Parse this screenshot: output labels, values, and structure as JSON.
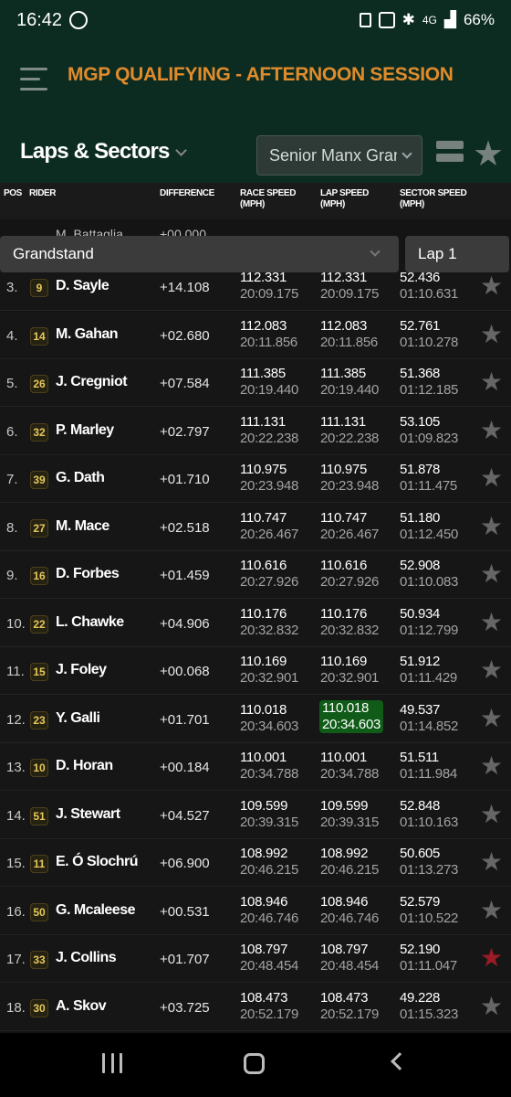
{
  "status_bar": {
    "time": "16:42",
    "battery": "66%",
    "network": "4G"
  },
  "header": {
    "title": "MGP QUALIFYING - AFTERNOON SESSION",
    "view_selector": "Laps & Sectors",
    "race_selector": "Senior Manx Grand Prix"
  },
  "columns": {
    "pos": "POS",
    "rider": "RIDER",
    "difference": "DIFFERENCE",
    "race_speed": "RACE SPEED (MPH)",
    "lap_speed": "LAP SPEED (MPH)",
    "sector_speed": "SECTOR SPEED (MPH)"
  },
  "partial_row": {
    "rider": "M. Battaglia",
    "diff": "+00.000"
  },
  "filters": {
    "sector": "Grandstand",
    "lap": "Lap 1"
  },
  "rows": [
    {
      "pos": "3.",
      "num": "9",
      "rider": "D. Sayle",
      "diff": "+14.108",
      "race_speed": "112.331",
      "race_time": "20:09.175",
      "lap_speed": "112.331",
      "lap_time": "20:09.175",
      "sector_speed": "52.436",
      "sector_time": "01:10.631",
      "best": false,
      "fav": false
    },
    {
      "pos": "4.",
      "num": "14",
      "rider": "M. Gahan",
      "diff": "+02.680",
      "race_speed": "112.083",
      "race_time": "20:11.856",
      "lap_speed": "112.083",
      "lap_time": "20:11.856",
      "sector_speed": "52.761",
      "sector_time": "01:10.278",
      "best": false,
      "fav": false
    },
    {
      "pos": "5.",
      "num": "26",
      "rider": "J. Cregniot",
      "diff": "+07.584",
      "race_speed": "111.385",
      "race_time": "20:19.440",
      "lap_speed": "111.385",
      "lap_time": "20:19.440",
      "sector_speed": "51.368",
      "sector_time": "01:12.185",
      "best": false,
      "fav": false
    },
    {
      "pos": "6.",
      "num": "32",
      "rider": "P. Marley",
      "diff": "+02.797",
      "race_speed": "111.131",
      "race_time": "20:22.238",
      "lap_speed": "111.131",
      "lap_time": "20:22.238",
      "sector_speed": "53.105",
      "sector_time": "01:09.823",
      "best": false,
      "fav": false
    },
    {
      "pos": "7.",
      "num": "39",
      "rider": "G. Dath",
      "diff": "+01.710",
      "race_speed": "110.975",
      "race_time": "20:23.948",
      "lap_speed": "110.975",
      "lap_time": "20:23.948",
      "sector_speed": "51.878",
      "sector_time": "01:11.475",
      "best": false,
      "fav": false
    },
    {
      "pos": "8.",
      "num": "27",
      "rider": "M. Mace",
      "diff": "+02.518",
      "race_speed": "110.747",
      "race_time": "20:26.467",
      "lap_speed": "110.747",
      "lap_time": "20:26.467",
      "sector_speed": "51.180",
      "sector_time": "01:12.450",
      "best": false,
      "fav": false
    },
    {
      "pos": "9.",
      "num": "16",
      "rider": "D. Forbes",
      "diff": "+01.459",
      "race_speed": "110.616",
      "race_time": "20:27.926",
      "lap_speed": "110.616",
      "lap_time": "20:27.926",
      "sector_speed": "52.908",
      "sector_time": "01:10.083",
      "best": false,
      "fav": false
    },
    {
      "pos": "10.",
      "num": "22",
      "rider": "L. Chawke",
      "diff": "+04.906",
      "race_speed": "110.176",
      "race_time": "20:32.832",
      "lap_speed": "110.176",
      "lap_time": "20:32.832",
      "sector_speed": "50.934",
      "sector_time": "01:12.799",
      "best": false,
      "fav": false
    },
    {
      "pos": "11.",
      "num": "15",
      "rider": "J. Foley",
      "diff": "+00.068",
      "race_speed": "110.169",
      "race_time": "20:32.901",
      "lap_speed": "110.169",
      "lap_time": "20:32.901",
      "sector_speed": "51.912",
      "sector_time": "01:11.429",
      "best": false,
      "fav": false
    },
    {
      "pos": "12.",
      "num": "23",
      "rider": "Y. Galli",
      "diff": "+01.701",
      "race_speed": "110.018",
      "race_time": "20:34.603",
      "lap_speed": "110.018",
      "lap_time": "20:34.603",
      "sector_speed": "49.537",
      "sector_time": "01:14.852",
      "best": true,
      "fav": false
    },
    {
      "pos": "13.",
      "num": "10",
      "rider": "D. Horan",
      "diff": "+00.184",
      "race_speed": "110.001",
      "race_time": "20:34.788",
      "lap_speed": "110.001",
      "lap_time": "20:34.788",
      "sector_speed": "51.511",
      "sector_time": "01:11.984",
      "best": false,
      "fav": false
    },
    {
      "pos": "14.",
      "num": "51",
      "rider": "J. Stewart",
      "diff": "+04.527",
      "race_speed": "109.599",
      "race_time": "20:39.315",
      "lap_speed": "109.599",
      "lap_time": "20:39.315",
      "sector_speed": "52.848",
      "sector_time": "01:10.163",
      "best": false,
      "fav": false
    },
    {
      "pos": "15.",
      "num": "11",
      "rider": "E. Ó Slochrú",
      "diff": "+06.900",
      "race_speed": "108.992",
      "race_time": "20:46.215",
      "lap_speed": "108.992",
      "lap_time": "20:46.215",
      "sector_speed": "50.605",
      "sector_time": "01:13.273",
      "best": false,
      "fav": false
    },
    {
      "pos": "16.",
      "num": "50",
      "rider": "G. Mcaleese",
      "diff": "+00.531",
      "race_speed": "108.946",
      "race_time": "20:46.746",
      "lap_speed": "108.946",
      "lap_time": "20:46.746",
      "sector_speed": "52.579",
      "sector_time": "01:10.522",
      "best": false,
      "fav": false
    },
    {
      "pos": "17.",
      "num": "33",
      "rider": "J. Collins",
      "diff": "+01.707",
      "race_speed": "108.797",
      "race_time": "20:48.454",
      "lap_speed": "108.797",
      "lap_time": "20:48.454",
      "sector_speed": "52.190",
      "sector_time": "01:11.047",
      "best": false,
      "fav": true
    },
    {
      "pos": "18.",
      "num": "30",
      "rider": "A. Skov",
      "diff": "+03.725",
      "race_speed": "108.473",
      "race_time": "20:52.179",
      "lap_speed": "108.473",
      "lap_time": "20:52.179",
      "sector_speed": "49.228",
      "sector_time": "01:15.323",
      "best": false,
      "fav": false
    }
  ]
}
